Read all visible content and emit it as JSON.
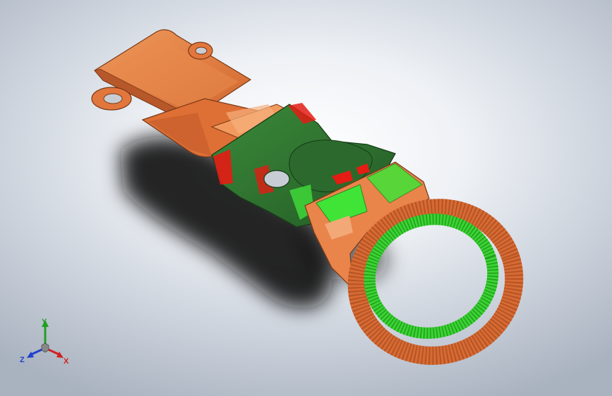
{
  "viewport": {
    "background_colors": [
      "#ffffff",
      "#a9b2bf"
    ],
    "model_colors": {
      "copper": "#e27a3f",
      "copper_dark": "#b2552a",
      "copper_light": "#f3a877",
      "green_dark": "#2e6e2f",
      "green_bright": "#35e02f",
      "red": "#e41c14"
    }
  },
  "triad": {
    "x_label": "X",
    "y_label": "Y",
    "z_label": "Z",
    "x_color": "#d02020",
    "y_color": "#20a020",
    "z_color": "#2040d0"
  }
}
